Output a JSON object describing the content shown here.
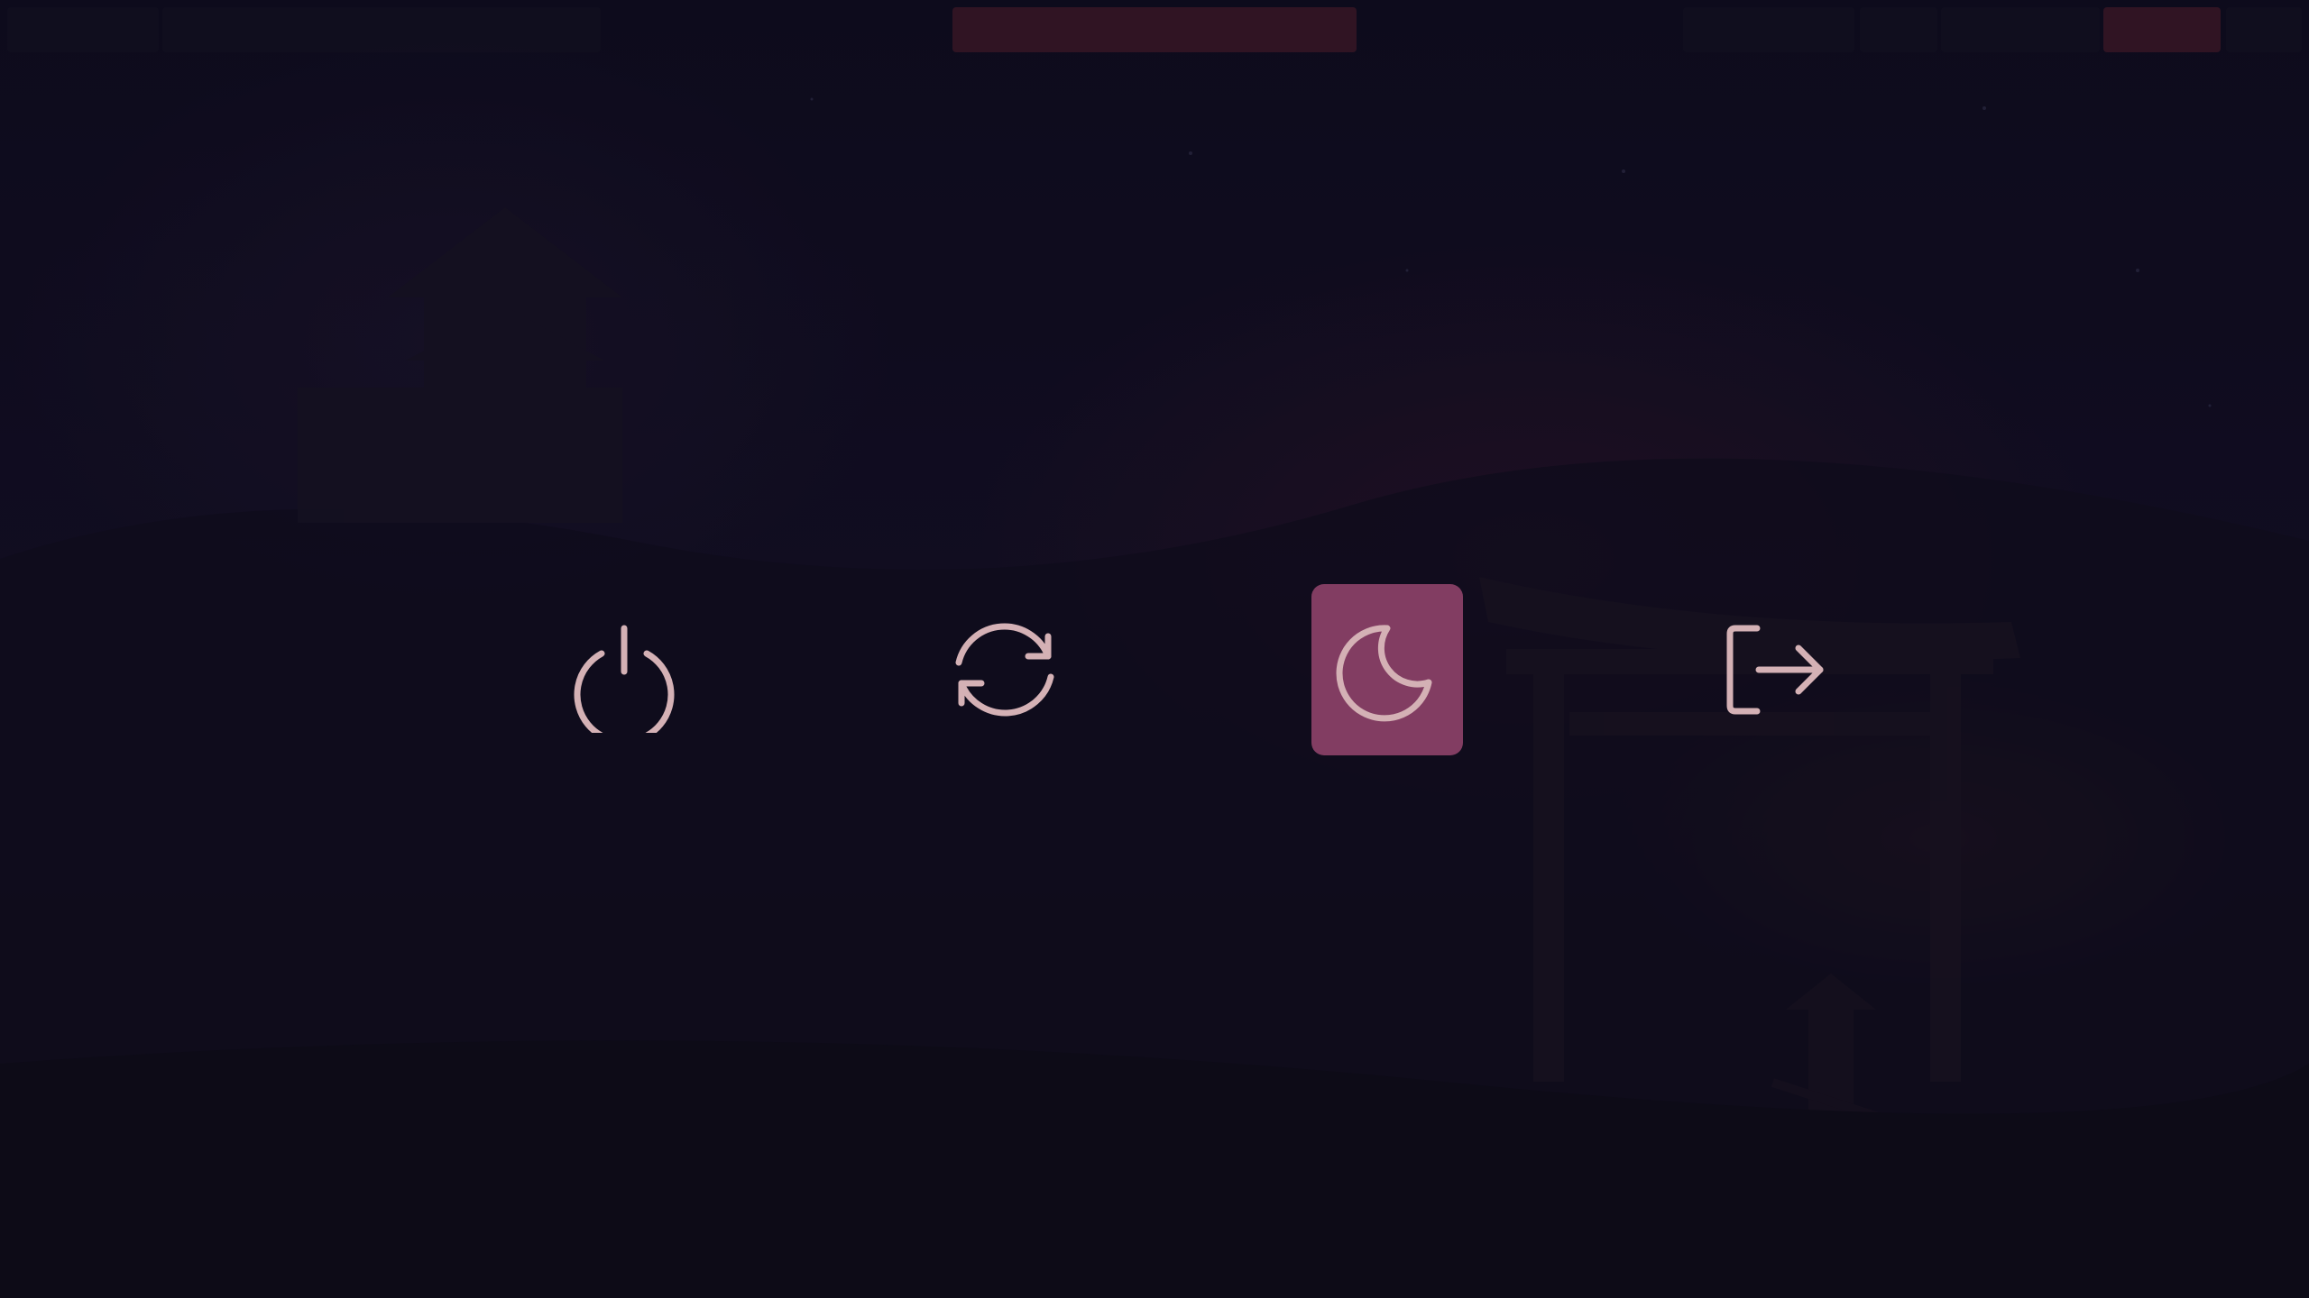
{
  "power_menu": {
    "buttons": [
      {
        "action": "shutdown",
        "icon": "power-icon",
        "selected": false
      },
      {
        "action": "reboot",
        "icon": "refresh-icon",
        "selected": false
      },
      {
        "action": "suspend",
        "icon": "moon-icon",
        "selected": true
      },
      {
        "action": "logout",
        "icon": "logout-icon",
        "selected": false
      }
    ],
    "colors": {
      "icon": "#d4b1b5",
      "selected_background": "#96466e",
      "overlay": "#0d0c1a"
    }
  }
}
